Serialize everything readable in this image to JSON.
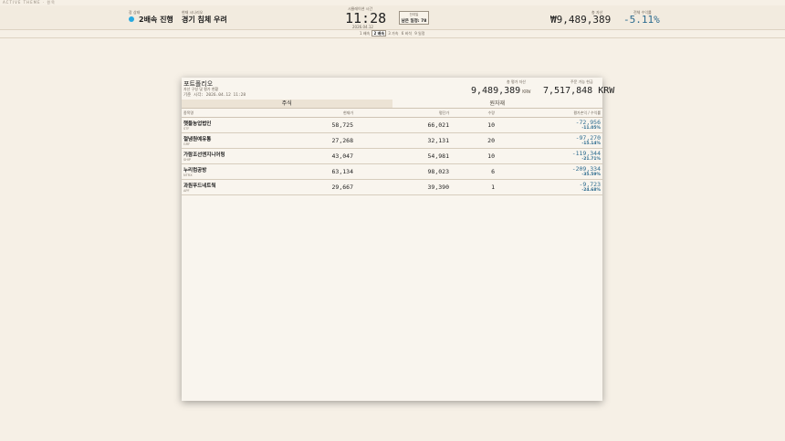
{
  "theme_label": "ACTIVE THEME · 원목",
  "header": {
    "game_status_label": "장 상태",
    "speed_text": "2배속 진행",
    "scenario_label": "현재 시나리오",
    "scenario_text": "경기 침체 우려",
    "sim_time_label": "시뮬레이션 시간",
    "sim_time": "11:28",
    "sim_date": "2026.04.12",
    "remaining_label": "잔여일",
    "remaining_text": "남은 일정: 78",
    "speed_options": [
      "1 배속",
      "2 배속",
      "3 가속",
      "6 비석",
      "9 일정"
    ],
    "assets_label": "총 자산",
    "assets_value": "₩9,489,389",
    "return_label": "전체 수익률",
    "return_value": "-5.11%",
    "accent_color": "#27a9e1"
  },
  "portfolio": {
    "title": "포트폴리오",
    "subtitle": "자산 구성 및 평가 현황",
    "as_of": "기준 시각: 2026.04.12 11:28",
    "total_label": "총 평가 자산",
    "total_value": "9,489,389",
    "total_unit": "KRW",
    "cash_label": "주문 가능 현금",
    "cash_value": "7,517,848 KRW",
    "tabs": [
      {
        "label": "주식",
        "active": true
      },
      {
        "label": "원자재",
        "active": false
      }
    ],
    "columns": [
      "종목명",
      "현재가",
      "평단가",
      "수량",
      "평가손익 / 수익률"
    ],
    "rows": [
      {
        "name": "햇들농업법인",
        "ticker": "STF",
        "price": "58,725",
        "avg": "66,021",
        "qty": "10",
        "pl": "-72,956",
        "pct": "-11.05%"
      },
      {
        "name": "철냄원예유통",
        "ticker": "GRF",
        "price": "27,268",
        "avg": "32,131",
        "qty": "20",
        "pl": "-97,270",
        "pct": "-15.14%"
      },
      {
        "name": "가람조선엔지니어링",
        "ticker": "SHIP",
        "price": "43,047",
        "avg": "54,981",
        "qty": "10",
        "pl": "-119,344",
        "pct": "-21.71%"
      },
      {
        "name": "누리컴공방",
        "ticker": "NTRX",
        "price": "63,134",
        "avg": "98,023",
        "qty": "6",
        "pl": "-209,334",
        "pct": "-35.59%"
      },
      {
        "name": "과원푸드네트웍",
        "ticker": "APF",
        "price": "29,667",
        "avg": "39,390",
        "qty": "1",
        "pl": "-9,723",
        "pct": "-24.68%"
      }
    ]
  }
}
